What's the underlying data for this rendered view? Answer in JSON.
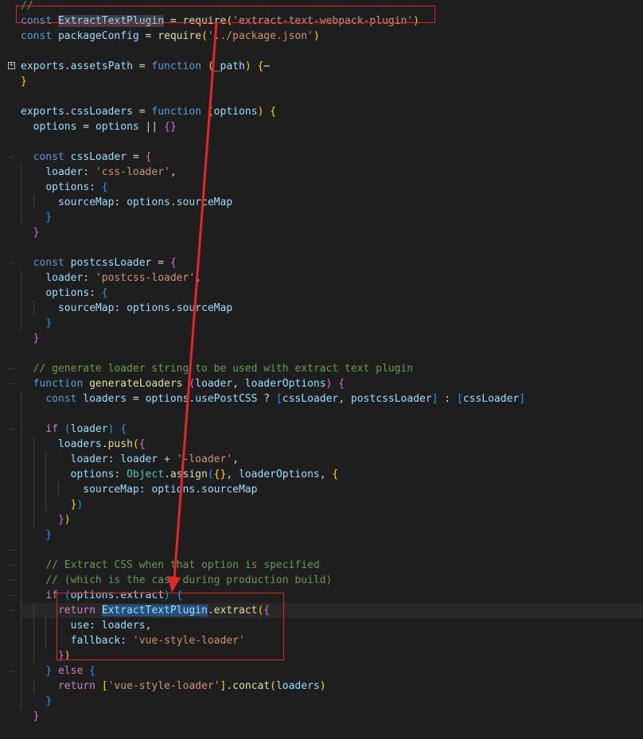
{
  "editor": {
    "lines": [
      [
        {
          "t": "//",
          "c": "cmt"
        }
      ],
      [
        {
          "t": "const",
          "c": "kw"
        },
        {
          "t": " ",
          "c": "plain"
        },
        {
          "t": "ExtractTextPlugin",
          "c": "var hl"
        },
        {
          "t": " = ",
          "c": "plain"
        },
        {
          "t": "require",
          "c": "fn"
        },
        {
          "t": "(",
          "c": "p1"
        },
        {
          "t": "'extract-text-webpack-plugin'",
          "c": "str"
        },
        {
          "t": ")",
          "c": "p1"
        }
      ],
      [
        {
          "t": "const",
          "c": "kw"
        },
        {
          "t": " ",
          "c": "plain"
        },
        {
          "t": "packageConfig",
          "c": "var"
        },
        {
          "t": " = ",
          "c": "plain"
        },
        {
          "t": "require",
          "c": "fn"
        },
        {
          "t": "(",
          "c": "p1"
        },
        {
          "t": "'../package.json'",
          "c": "str"
        },
        {
          "t": ")",
          "c": "p1"
        }
      ],
      [],
      [
        {
          "t": "exports",
          "c": "var"
        },
        {
          "t": ".",
          "c": "plain"
        },
        {
          "t": "assetsPath",
          "c": "var"
        },
        {
          "t": " = ",
          "c": "plain"
        },
        {
          "t": "function",
          "c": "kw"
        },
        {
          "t": " ",
          "c": "plain"
        },
        {
          "t": "(",
          "c": "p1"
        },
        {
          "t": "_path",
          "c": "var"
        },
        {
          "t": ")",
          "c": "p1"
        },
        {
          "t": " ",
          "c": "plain"
        },
        {
          "t": "{",
          "c": "p1"
        },
        {
          "t": "⋯",
          "c": "plain"
        }
      ],
      [
        {
          "t": "}",
          "c": "p1"
        }
      ],
      [],
      [
        {
          "t": "exports",
          "c": "var"
        },
        {
          "t": ".",
          "c": "plain"
        },
        {
          "t": "cssLoaders",
          "c": "var"
        },
        {
          "t": " = ",
          "c": "plain"
        },
        {
          "t": "function",
          "c": "kw"
        },
        {
          "t": " ",
          "c": "plain"
        },
        {
          "t": "(",
          "c": "p1"
        },
        {
          "t": "options",
          "c": "var"
        },
        {
          "t": ")",
          "c": "p1"
        },
        {
          "t": " ",
          "c": "plain"
        },
        {
          "t": "{",
          "c": "p1"
        }
      ],
      [
        {
          "t": "  ",
          "c": "plain"
        },
        {
          "t": "options",
          "c": "var"
        },
        {
          "t": " = ",
          "c": "plain"
        },
        {
          "t": "options",
          "c": "var"
        },
        {
          "t": " || ",
          "c": "plain"
        },
        {
          "t": "{}",
          "c": "p2"
        }
      ],
      [],
      [
        {
          "t": "  ",
          "c": "plain"
        },
        {
          "t": "const",
          "c": "kw"
        },
        {
          "t": " ",
          "c": "plain"
        },
        {
          "t": "cssLoader",
          "c": "var"
        },
        {
          "t": " = ",
          "c": "plain"
        },
        {
          "t": "{",
          "c": "p2"
        }
      ],
      [
        {
          "t": "    ",
          "c": "plain"
        },
        {
          "t": "loader",
          "c": "var"
        },
        {
          "t": ": ",
          "c": "plain"
        },
        {
          "t": "'css-loader'",
          "c": "str"
        },
        {
          "t": ",",
          "c": "plain"
        }
      ],
      [
        {
          "t": "    ",
          "c": "plain"
        },
        {
          "t": "options",
          "c": "var"
        },
        {
          "t": ": ",
          "c": "plain"
        },
        {
          "t": "{",
          "c": "p3"
        }
      ],
      [
        {
          "t": "      ",
          "c": "plain"
        },
        {
          "t": "sourceMap",
          "c": "var"
        },
        {
          "t": ": ",
          "c": "plain"
        },
        {
          "t": "options",
          "c": "var"
        },
        {
          "t": ".",
          "c": "plain"
        },
        {
          "t": "sourceMap",
          "c": "var"
        }
      ],
      [
        {
          "t": "    ",
          "c": "plain"
        },
        {
          "t": "}",
          "c": "p3"
        }
      ],
      [
        {
          "t": "  ",
          "c": "plain"
        },
        {
          "t": "}",
          "c": "p2"
        }
      ],
      [],
      [
        {
          "t": "  ",
          "c": "plain"
        },
        {
          "t": "const",
          "c": "kw"
        },
        {
          "t": " ",
          "c": "plain"
        },
        {
          "t": "postcssLoader",
          "c": "var"
        },
        {
          "t": " = ",
          "c": "plain"
        },
        {
          "t": "{",
          "c": "p2"
        }
      ],
      [
        {
          "t": "    ",
          "c": "plain"
        },
        {
          "t": "loader",
          "c": "var"
        },
        {
          "t": ": ",
          "c": "plain"
        },
        {
          "t": "'postcss-loader'",
          "c": "str"
        },
        {
          "t": ",",
          "c": "plain"
        }
      ],
      [
        {
          "t": "    ",
          "c": "plain"
        },
        {
          "t": "options",
          "c": "var"
        },
        {
          "t": ": ",
          "c": "plain"
        },
        {
          "t": "{",
          "c": "p3"
        }
      ],
      [
        {
          "t": "      ",
          "c": "plain"
        },
        {
          "t": "sourceMap",
          "c": "var"
        },
        {
          "t": ": ",
          "c": "plain"
        },
        {
          "t": "options",
          "c": "var"
        },
        {
          "t": ".",
          "c": "plain"
        },
        {
          "t": "sourceMap",
          "c": "var"
        }
      ],
      [
        {
          "t": "    ",
          "c": "plain"
        },
        {
          "t": "}",
          "c": "p3"
        }
      ],
      [
        {
          "t": "  ",
          "c": "plain"
        },
        {
          "t": "}",
          "c": "p2"
        }
      ],
      [],
      [
        {
          "t": "  ",
          "c": "plain"
        },
        {
          "t": "// generate loader string to be used with extract text plugin",
          "c": "cmt"
        }
      ],
      [
        {
          "t": "  ",
          "c": "plain"
        },
        {
          "t": "function",
          "c": "kw"
        },
        {
          "t": " ",
          "c": "plain"
        },
        {
          "t": "generateLoaders",
          "c": "fn"
        },
        {
          "t": " ",
          "c": "plain"
        },
        {
          "t": "(",
          "c": "p2"
        },
        {
          "t": "loader",
          "c": "var"
        },
        {
          "t": ", ",
          "c": "plain"
        },
        {
          "t": "loaderOptions",
          "c": "var"
        },
        {
          "t": ")",
          "c": "p2"
        },
        {
          "t": " ",
          "c": "plain"
        },
        {
          "t": "{",
          "c": "p2"
        }
      ],
      [
        {
          "t": "    ",
          "c": "plain"
        },
        {
          "t": "const",
          "c": "kw"
        },
        {
          "t": " ",
          "c": "plain"
        },
        {
          "t": "loaders",
          "c": "var"
        },
        {
          "t": " = ",
          "c": "plain"
        },
        {
          "t": "options",
          "c": "var"
        },
        {
          "t": ".",
          "c": "plain"
        },
        {
          "t": "usePostCSS",
          "c": "var"
        },
        {
          "t": " ? ",
          "c": "plain"
        },
        {
          "t": "[",
          "c": "p3"
        },
        {
          "t": "cssLoader",
          "c": "var"
        },
        {
          "t": ", ",
          "c": "plain"
        },
        {
          "t": "postcssLoader",
          "c": "var"
        },
        {
          "t": "]",
          "c": "p3"
        },
        {
          "t": " : ",
          "c": "plain"
        },
        {
          "t": "[",
          "c": "p3"
        },
        {
          "t": "cssLoader",
          "c": "var"
        },
        {
          "t": "]",
          "c": "p3"
        }
      ],
      [],
      [
        {
          "t": "    ",
          "c": "plain"
        },
        {
          "t": "if",
          "c": "ctl"
        },
        {
          "t": " ",
          "c": "plain"
        },
        {
          "t": "(",
          "c": "p3"
        },
        {
          "t": "loader",
          "c": "var"
        },
        {
          "t": ")",
          "c": "p3"
        },
        {
          "t": " ",
          "c": "plain"
        },
        {
          "t": "{",
          "c": "p3"
        }
      ],
      [
        {
          "t": "      ",
          "c": "plain"
        },
        {
          "t": "loaders",
          "c": "var"
        },
        {
          "t": ".",
          "c": "plain"
        },
        {
          "t": "push",
          "c": "fn"
        },
        {
          "t": "(",
          "c": "p1"
        },
        {
          "t": "{",
          "c": "p2"
        }
      ],
      [
        {
          "t": "        ",
          "c": "plain"
        },
        {
          "t": "loader",
          "c": "var"
        },
        {
          "t": ": ",
          "c": "plain"
        },
        {
          "t": "loader",
          "c": "var"
        },
        {
          "t": " + ",
          "c": "plain"
        },
        {
          "t": "'-loader'",
          "c": "str"
        },
        {
          "t": ",",
          "c": "plain"
        }
      ],
      [
        {
          "t": "        ",
          "c": "plain"
        },
        {
          "t": "options",
          "c": "var"
        },
        {
          "t": ": ",
          "c": "plain"
        },
        {
          "t": "Object",
          "c": "cls"
        },
        {
          "t": ".",
          "c": "plain"
        },
        {
          "t": "assign",
          "c": "fn"
        },
        {
          "t": "(",
          "c": "p3"
        },
        {
          "t": "{}",
          "c": "p1"
        },
        {
          "t": ", ",
          "c": "plain"
        },
        {
          "t": "loaderOptions",
          "c": "var"
        },
        {
          "t": ", ",
          "c": "plain"
        },
        {
          "t": "{",
          "c": "p1"
        }
      ],
      [
        {
          "t": "          ",
          "c": "plain"
        },
        {
          "t": "sourceMap",
          "c": "var"
        },
        {
          "t": ": ",
          "c": "plain"
        },
        {
          "t": "options",
          "c": "var"
        },
        {
          "t": ".",
          "c": "plain"
        },
        {
          "t": "sourceMap",
          "c": "var"
        }
      ],
      [
        {
          "t": "        ",
          "c": "plain"
        },
        {
          "t": "}",
          "c": "p1"
        },
        {
          "t": ")",
          "c": "p3"
        }
      ],
      [
        {
          "t": "      ",
          "c": "plain"
        },
        {
          "t": "}",
          "c": "p2"
        },
        {
          "t": ")",
          "c": "p1"
        }
      ],
      [
        {
          "t": "    ",
          "c": "plain"
        },
        {
          "t": "}",
          "c": "p3"
        }
      ],
      [],
      [
        {
          "t": "    ",
          "c": "plain"
        },
        {
          "t": "// Extract CSS when that option is specified",
          "c": "cmt"
        }
      ],
      [
        {
          "t": "    ",
          "c": "plain"
        },
        {
          "t": "// (which is the case during production build)",
          "c": "cmt"
        }
      ],
      [
        {
          "t": "    ",
          "c": "plain"
        },
        {
          "t": "if",
          "c": "ctl"
        },
        {
          "t": " ",
          "c": "plain"
        },
        {
          "t": "(",
          "c": "p3"
        },
        {
          "t": "options",
          "c": "var"
        },
        {
          "t": ".",
          "c": "plain"
        },
        {
          "t": "extract",
          "c": "var"
        },
        {
          "t": ")",
          "c": "p3"
        },
        {
          "t": " ",
          "c": "plain"
        },
        {
          "t": "{",
          "c": "p3"
        }
      ],
      [
        {
          "t": "      ",
          "c": "plain"
        },
        {
          "t": "return",
          "c": "ctl"
        },
        {
          "t": " ",
          "c": "plain"
        },
        {
          "t": "ExtractTextPlugin",
          "c": "var sel"
        },
        {
          "t": ".",
          "c": "plain"
        },
        {
          "t": "extract",
          "c": "fn"
        },
        {
          "t": "(",
          "c": "p1"
        },
        {
          "t": "{",
          "c": "p2"
        }
      ],
      [
        {
          "t": "        ",
          "c": "plain"
        },
        {
          "t": "use",
          "c": "var"
        },
        {
          "t": ": ",
          "c": "plain"
        },
        {
          "t": "loaders",
          "c": "var"
        },
        {
          "t": ",",
          "c": "plain"
        }
      ],
      [
        {
          "t": "        ",
          "c": "plain"
        },
        {
          "t": "fallback",
          "c": "var"
        },
        {
          "t": ": ",
          "c": "plain"
        },
        {
          "t": "'vue-style-loader'",
          "c": "str"
        }
      ],
      [
        {
          "t": "      ",
          "c": "plain"
        },
        {
          "t": "}",
          "c": "p2"
        },
        {
          "t": ")",
          "c": "p1"
        }
      ],
      [
        {
          "t": "    ",
          "c": "plain"
        },
        {
          "t": "}",
          "c": "p3"
        },
        {
          "t": " ",
          "c": "plain"
        },
        {
          "t": "else",
          "c": "ctl"
        },
        {
          "t": " ",
          "c": "plain"
        },
        {
          "t": "{",
          "c": "p3"
        }
      ],
      [
        {
          "t": "      ",
          "c": "plain"
        },
        {
          "t": "return",
          "c": "ctl"
        },
        {
          "t": " ",
          "c": "plain"
        },
        {
          "t": "[",
          "c": "p1"
        },
        {
          "t": "'vue-style-loader'",
          "c": "str"
        },
        {
          "t": "]",
          "c": "p1"
        },
        {
          "t": ".",
          "c": "plain"
        },
        {
          "t": "concat",
          "c": "fn"
        },
        {
          "t": "(",
          "c": "p1"
        },
        {
          "t": "loaders",
          "c": "var"
        },
        {
          "t": ")",
          "c": "p1"
        }
      ],
      [
        {
          "t": "    ",
          "c": "plain"
        },
        {
          "t": "}",
          "c": "p3"
        }
      ],
      [
        {
          "t": "  ",
          "c": "plain"
        },
        {
          "t": "}",
          "c": "p2"
        }
      ],
      [
        {
          "t": "",
          "c": "plain"
        }
      ]
    ],
    "folded_line_index": 4,
    "cursor_line_index": 40,
    "gutter_mark_line_indexes": [
      10,
      17,
      24,
      25,
      28,
      36,
      37,
      38,
      39,
      40,
      44
    ]
  },
  "icons": {
    "fold": "fold-expand-icon"
  },
  "annotations": {
    "color": "#e2262b",
    "description_boxes": [
      "import-line-box",
      "extract-call-box"
    ],
    "arrow": "annotation-arrow"
  }
}
